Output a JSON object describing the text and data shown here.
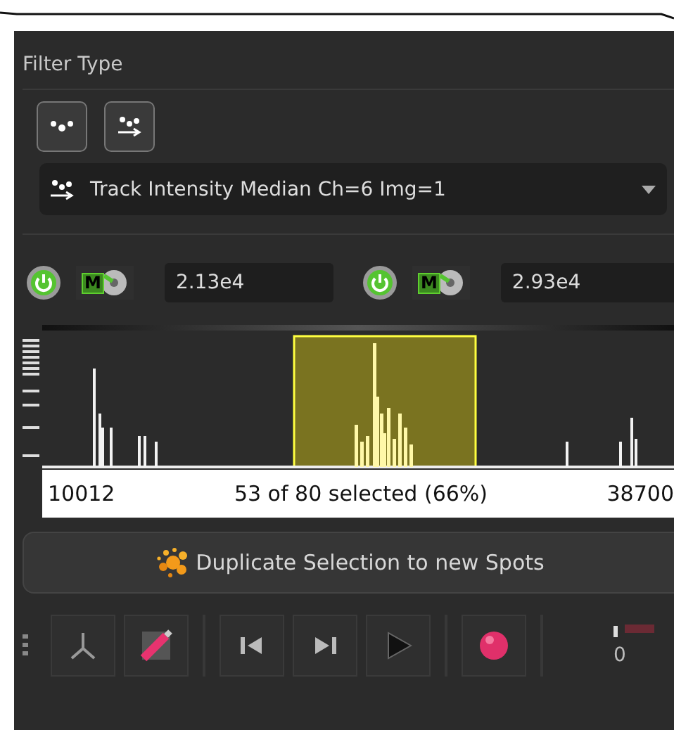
{
  "section_title": "Filter Type",
  "filter_buttons": [
    {
      "kind": "spots",
      "selected": false
    },
    {
      "kind": "tracks",
      "selected": false
    }
  ],
  "filter_dropdown": {
    "value": "Track Intensity Median Ch=6 Img=1"
  },
  "thresholds": [
    {
      "on": true,
      "mode_badge": "M",
      "value": "2.13e4"
    },
    {
      "on": true,
      "mode_badge": "M",
      "value": "2.93e4"
    }
  ],
  "histogram": {
    "min": "10012",
    "summary": "53 of 80 selected (66%)",
    "max": "38700"
  },
  "duplicate_button": "Duplicate Selection to new Spots",
  "toolbar": [
    {
      "kind": "axes"
    },
    {
      "kind": "pointer"
    },
    {
      "kind": "skip-back"
    },
    {
      "kind": "skip-forward"
    },
    {
      "kind": "play"
    },
    {
      "kind": "record"
    }
  ],
  "time_value": "0"
}
